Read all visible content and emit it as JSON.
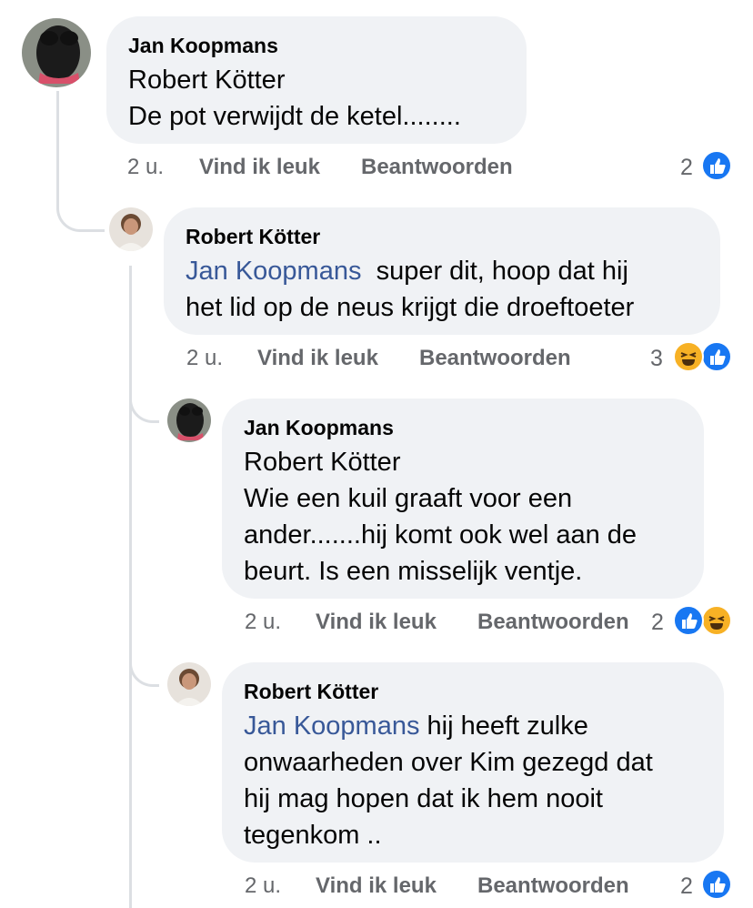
{
  "comments": [
    {
      "author": "Jan Koopmans",
      "mention": "Robert Kötter",
      "text_line1": "De pot verwijdt de ketel........",
      "time": "2 u.",
      "like": "Vind ik leuk",
      "reply": "Beantwoorden",
      "reaction_count": "2",
      "reactions": [
        "like-icon"
      ]
    },
    {
      "author": "Robert Kötter",
      "mention": "Jan Koopmans",
      "text_after_mention": "  super dit, hoop dat hij",
      "text_line2": "het lid op de neus krijgt die droeftoeter",
      "time": "2 u.",
      "like": "Vind ik leuk",
      "reply": "Beantwoorden",
      "reaction_count": "3",
      "reactions": [
        "haha-icon",
        "like-icon"
      ]
    },
    {
      "author": "Jan Koopmans",
      "mention": "Robert Kötter",
      "text_line1": "Wie een kuil graaft voor een",
      "text_line2": "ander.......hij komt ook wel aan de",
      "text_line3": "beurt. Is een misselijk ventje.",
      "time": "2 u.",
      "like": "Vind ik leuk",
      "reply": "Beantwoorden",
      "reaction_count": "2",
      "reactions": [
        "like-icon",
        "haha-icon"
      ]
    },
    {
      "author": "Robert Kötter",
      "mention": "Jan Koopmans",
      "text_after_mention": " hij heeft zulke",
      "text_line2": "onwaarheden over Kim gezegd dat",
      "text_line3": "hij mag hopen dat ik hem nooit",
      "text_line4": "tegenkom ..",
      "time": "2 u.",
      "like": "Vind ik leuk",
      "reply": "Beantwoorden",
      "reaction_count": "2",
      "reactions": [
        "like-icon"
      ]
    }
  ],
  "colors": {
    "bubble": "#f0f2f5",
    "mention": "#385898",
    "meta": "#65676b",
    "like": "#1877f2",
    "haha": "#f7b125"
  }
}
